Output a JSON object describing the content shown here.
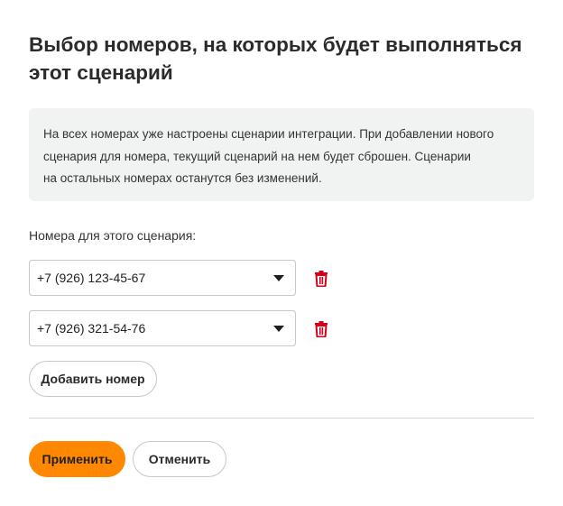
{
  "dialog": {
    "title": "Выбор номеров, на которых будет выполняться этот сценарий"
  },
  "notice": {
    "lines": [
      "На всех номерах уже настроены сценарии интеграции. При добавлении нового",
      "сценария для номера, текущий сценарий на нем будет сброшен. Сценарии",
      "на остальных номерах останутся без изменений."
    ]
  },
  "numbers": {
    "label": "Номера для этого сценария:",
    "items": [
      {
        "value": "+7 (926) 123-45-67"
      },
      {
        "value": "+7 (926) 321-54-76"
      }
    ],
    "add_label": "Добавить номер"
  },
  "actions": {
    "apply_label": "Применить",
    "cancel_label": "Отменить"
  },
  "icons": {
    "delete": "trash-icon",
    "dropdown": "chevron-down-icon"
  },
  "colors": {
    "accent": "#ff8800",
    "danger": "#d0021b",
    "notice_bg": "#f1f3f2"
  }
}
